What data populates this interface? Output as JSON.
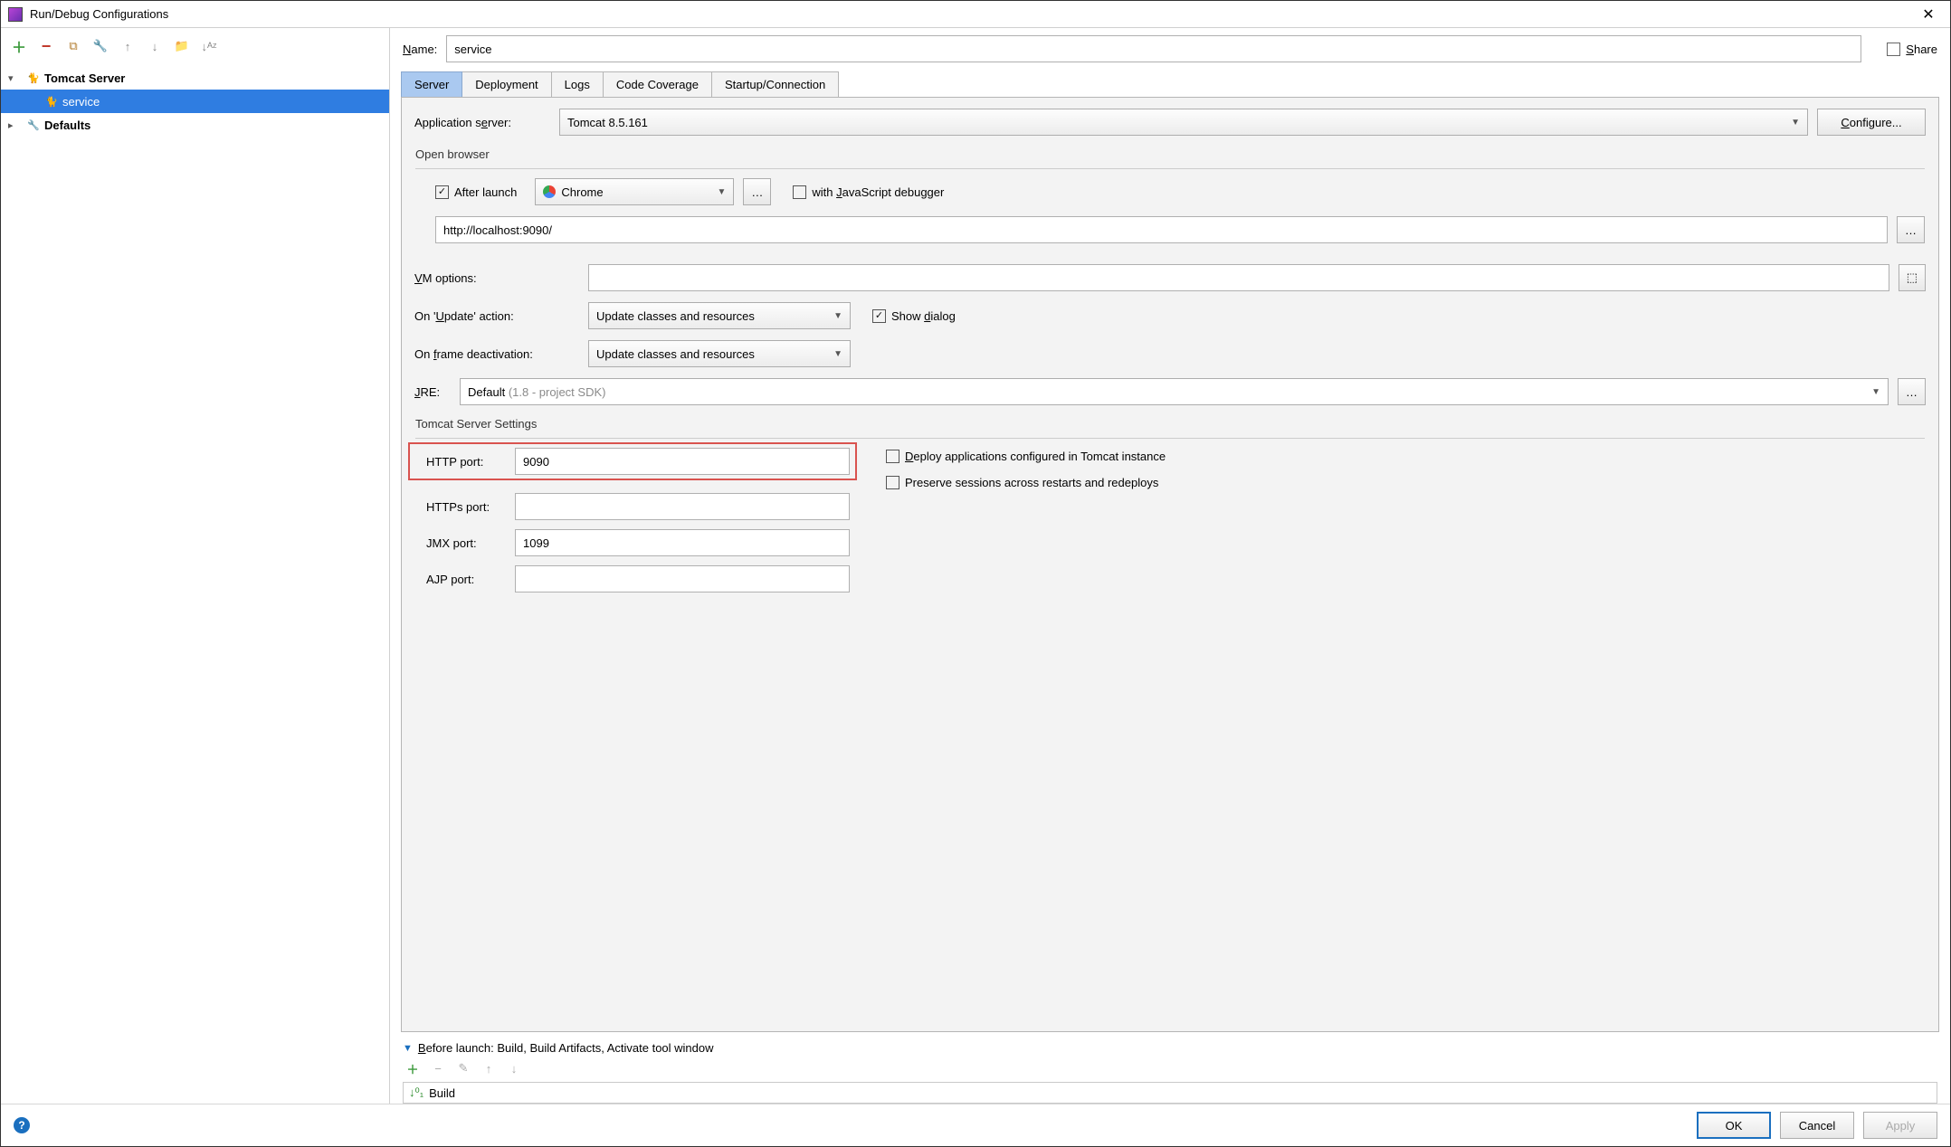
{
  "window": {
    "title": "Run/Debug Configurations"
  },
  "tree": {
    "tomcat_server": "Tomcat Server",
    "service": "service",
    "defaults": "Defaults"
  },
  "name": {
    "label": "Name:",
    "value": "service"
  },
  "share": {
    "label": "Share"
  },
  "tabs": {
    "server": "Server",
    "deployment": "Deployment",
    "logs": "Logs",
    "coverage": "Code Coverage",
    "startup": "Startup/Connection"
  },
  "form": {
    "app_server_label": "Application server:",
    "app_server_value": "Tomcat 8.5.161",
    "configure_btn": "Configure...",
    "open_browser_legend": "Open browser",
    "after_launch": "After launch",
    "browser_value": "Chrome",
    "with_js_debugger": "with JavaScript debugger",
    "url_value": "http://localhost:9090/",
    "vm_options_label": "VM options:",
    "vm_options_value": "",
    "on_update_label": "On 'Update' action:",
    "on_update_value": "Update classes and resources",
    "show_dialog": "Show dialog",
    "on_frame_label": "On frame deactivation:",
    "on_frame_value": "Update classes and resources",
    "jre_label": "JRE:",
    "jre_value_prefix": "Default ",
    "jre_value_suffix": "(1.8 - project SDK)",
    "tomcat_settings_legend": "Tomcat Server Settings",
    "http_port_label": "HTTP port:",
    "http_port_value": "9090",
    "https_port_label": "HTTPs port:",
    "https_port_value": "",
    "jmx_port_label": "JMX port:",
    "jmx_port_value": "1099",
    "ajp_port_label": "AJP port:",
    "ajp_port_value": "",
    "deploy_apps": "Deploy applications configured in Tomcat instance",
    "preserve_sessions": "Preserve sessions across restarts and redeploys"
  },
  "before_launch": {
    "header": "Before launch: Build, Build Artifacts, Activate tool window",
    "item": "Build"
  },
  "buttons": {
    "ok": "OK",
    "cancel": "Cancel",
    "apply": "Apply"
  }
}
